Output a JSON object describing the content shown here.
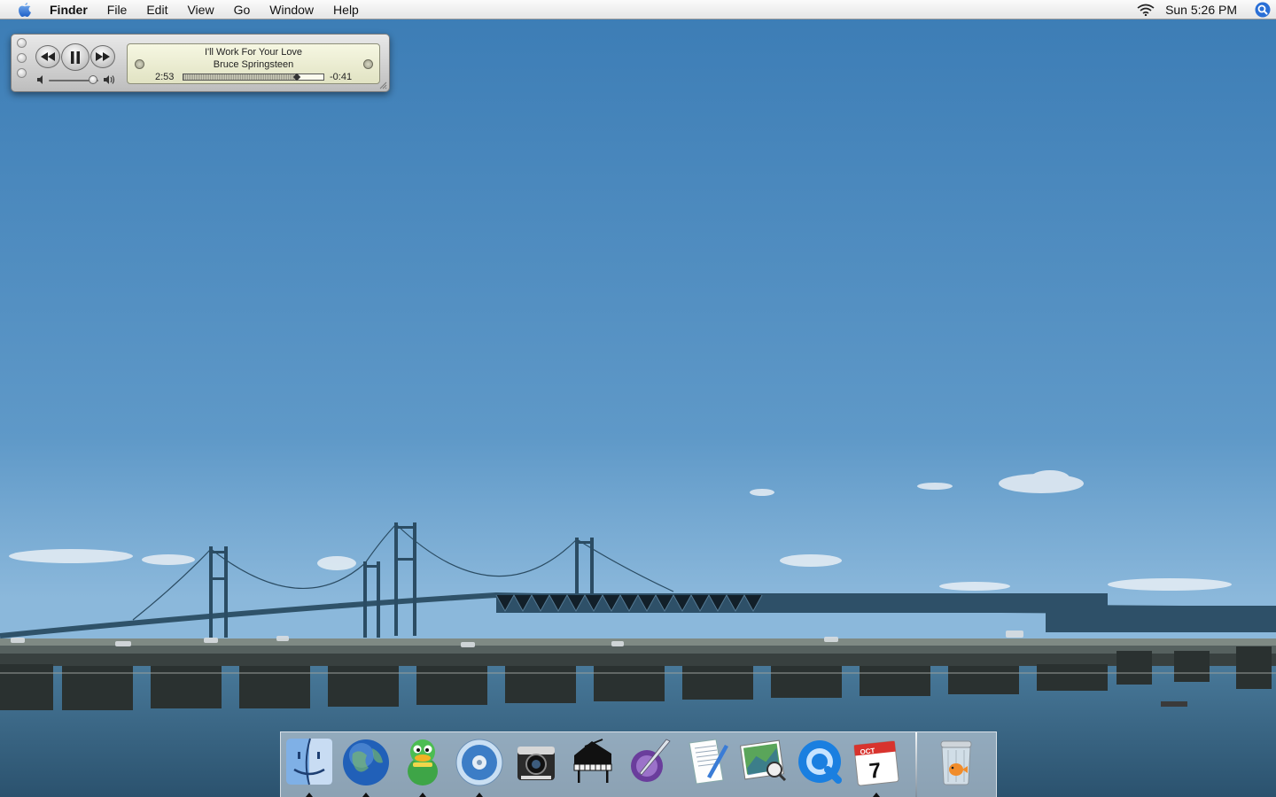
{
  "menubar": {
    "apple_icon": "apple-logo-icon",
    "app_name": "Finder",
    "menus": [
      "File",
      "Edit",
      "View",
      "Go",
      "Window",
      "Help"
    ],
    "clock": "Sun 5:26 PM",
    "wifi_icon": "wifi-icon",
    "spotlight_icon": "spotlight-search-icon"
  },
  "player": {
    "song": "I'll Work For Your Love",
    "artist": "Bruce Springsteen",
    "elapsed": "2:53",
    "remaining": "-0:41",
    "progress": 0.81,
    "volume": 0.9,
    "buttons": [
      "rewind-icon",
      "pause-icon",
      "fast-forward-icon"
    ]
  },
  "dock": {
    "apps": [
      {
        "name": "finder",
        "running": true
      },
      {
        "name": "network-browser",
        "running": true
      },
      {
        "name": "adium",
        "running": true
      },
      {
        "name": "dvd-player",
        "running": true
      },
      {
        "name": "photo-booth",
        "running": false
      },
      {
        "name": "garageband",
        "running": false
      },
      {
        "name": "quill-app",
        "running": false
      },
      {
        "name": "textedit",
        "running": false
      },
      {
        "name": "preview",
        "running": false
      },
      {
        "name": "quicktime",
        "running": false
      },
      {
        "name": "ical",
        "running": true
      }
    ],
    "ical_month": "OCT",
    "ical_day": "7",
    "trash": "trash-icon"
  },
  "colors": {
    "sky_top": "#3a7cb6",
    "sky_bottom": "#84b2d6",
    "water": "#33607f",
    "bridge": "#2e4f66"
  }
}
